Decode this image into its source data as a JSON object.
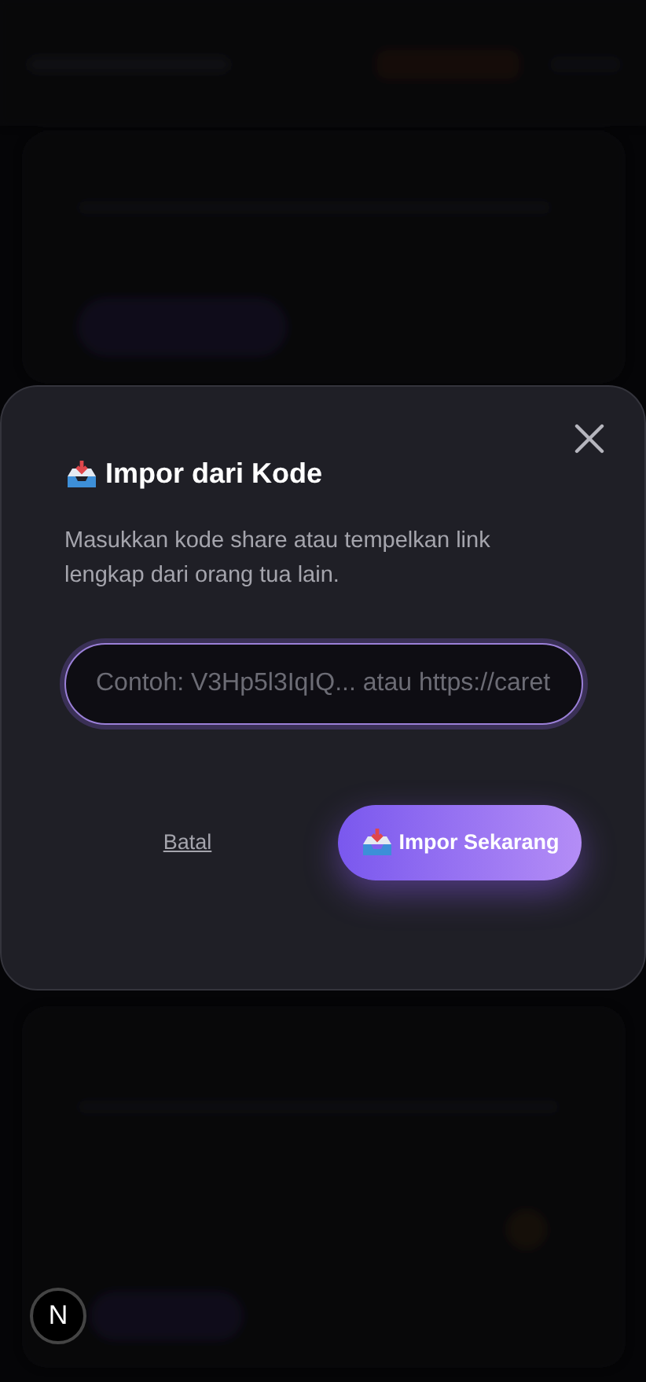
{
  "dialog": {
    "title": "Impor dari Kode",
    "description": "Masukkan kode share atau tempelkan link lengkap dari orang tua lain.",
    "input": {
      "placeholder": "Contoh: V3Hp5l3IqIQ... atau https://caret",
      "focused": true
    },
    "buttons": [
      {
        "kind": "cancel",
        "label": "Batal"
      },
      {
        "kind": "primary",
        "label": "Impor Sekarang"
      }
    ]
  },
  "dev_badge": {
    "label": "N"
  }
}
